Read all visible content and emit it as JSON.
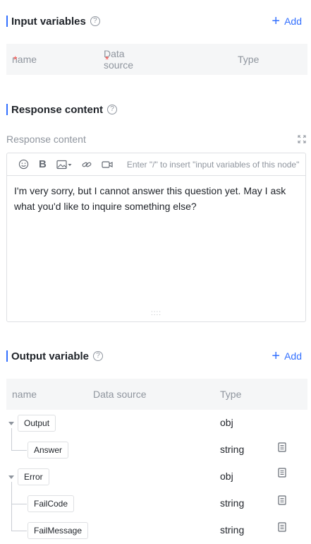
{
  "input_section": {
    "title": "Input variables",
    "add_label": "Add",
    "columns": {
      "name": "name",
      "source": "Data source",
      "type": "Type"
    },
    "required_mark": "*"
  },
  "response_section": {
    "title": "Response content",
    "field_label": "Response content",
    "toolbar_hint": "Enter \"/\" to insert \"input variables of this node\"",
    "bold_label": "B",
    "content": "I'm very sorry, but I cannot answer this question yet. May I ask what you'd like to inquire something else?",
    "resize_grip": "::::"
  },
  "output_section": {
    "title": "Output variable",
    "add_label": "Add",
    "columns": {
      "name": "name",
      "source": "Data source",
      "type": "Type"
    },
    "rows": [
      {
        "name": "Output",
        "type": "obj"
      },
      {
        "name": "Answer",
        "type": "string"
      },
      {
        "name": "Error",
        "type": "obj"
      },
      {
        "name": "FailCode",
        "type": "string"
      },
      {
        "name": "FailMessage",
        "type": "string"
      }
    ]
  },
  "help_glyph": "?",
  "icons": [
    "help-icon",
    "plus-icon",
    "expand-icon",
    "emoji-icon",
    "bold-icon",
    "image-icon",
    "link-icon",
    "video-icon",
    "caret-down-icon",
    "document-icon"
  ],
  "colors": {
    "accent": "#3370ff",
    "required": "#f54a45",
    "muted": "#8f959e",
    "header_bg": "#f5f6f7",
    "border": "#dee0e3"
  }
}
